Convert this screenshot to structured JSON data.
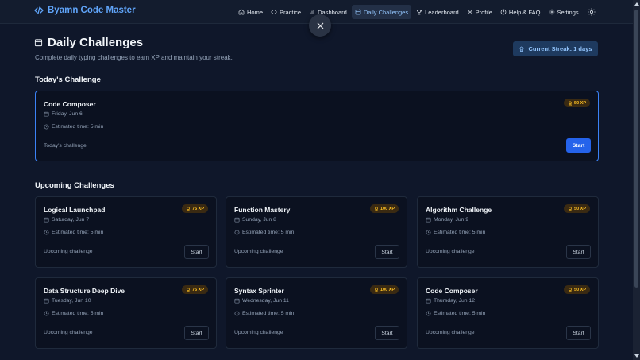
{
  "header": {
    "brand": "Byamn Code Master",
    "nav": [
      {
        "label": "Home",
        "icon": "home-icon",
        "active": false
      },
      {
        "label": "Practice",
        "icon": "code-icon",
        "active": false
      },
      {
        "label": "Dashboard",
        "icon": "chart-icon",
        "active": false
      },
      {
        "label": "Daily Challenges",
        "icon": "calendar-icon",
        "active": true
      },
      {
        "label": "Leaderboard",
        "icon": "trophy-icon",
        "active": false
      },
      {
        "label": "Profile",
        "icon": "user-icon",
        "active": false
      },
      {
        "label": "Help & FAQ",
        "icon": "help-icon",
        "active": false
      },
      {
        "label": "Settings",
        "icon": "gear-icon",
        "active": false
      }
    ],
    "theme_icon": "sun-icon"
  },
  "page": {
    "title": "Daily Challenges",
    "subtitle": "Complete daily typing challenges to earn XP and maintain your streak.",
    "streak": "Current Streak: 1 days"
  },
  "today": {
    "section_title": "Today's Challenge",
    "card": {
      "name": "Code Composer",
      "date": "Friday, Jun 6",
      "time": "Estimated time: 5 min",
      "status": "Today's challenge",
      "xp": "50 XP",
      "button": "Start"
    }
  },
  "upcoming": {
    "section_title": "Upcoming Challenges",
    "cards": [
      {
        "name": "Logical Launchpad",
        "date": "Saturday, Jun 7",
        "time": "Estimated time: 5 min",
        "status": "Upcoming challenge",
        "xp": "75 XP",
        "button": "Start"
      },
      {
        "name": "Function Mastery",
        "date": "Sunday, Jun 8",
        "time": "Estimated time: 5 min",
        "status": "Upcoming challenge",
        "xp": "100 XP",
        "button": "Start"
      },
      {
        "name": "Algorithm Challenge",
        "date": "Monday, Jun 9",
        "time": "Estimated time: 5 min",
        "status": "Upcoming challenge",
        "xp": "50 XP",
        "button": "Start"
      },
      {
        "name": "Data Structure Deep Dive",
        "date": "Tuesday, Jun 10",
        "time": "Estimated time: 5 min",
        "status": "Upcoming challenge",
        "xp": "75 XP",
        "button": "Start"
      },
      {
        "name": "Syntax Sprinter",
        "date": "Wednesday, Jun 11",
        "time": "Estimated time: 5 min",
        "status": "Upcoming challenge",
        "xp": "100 XP",
        "button": "Start"
      },
      {
        "name": "Code Composer",
        "date": "Thursday, Jun 12",
        "time": "Estimated time: 5 min",
        "status": "Upcoming challenge",
        "xp": "50 XP",
        "button": "Start"
      }
    ]
  },
  "colors": {
    "background": "#0f172a",
    "accent": "#3b82f6",
    "xp": "#fbbf24"
  }
}
